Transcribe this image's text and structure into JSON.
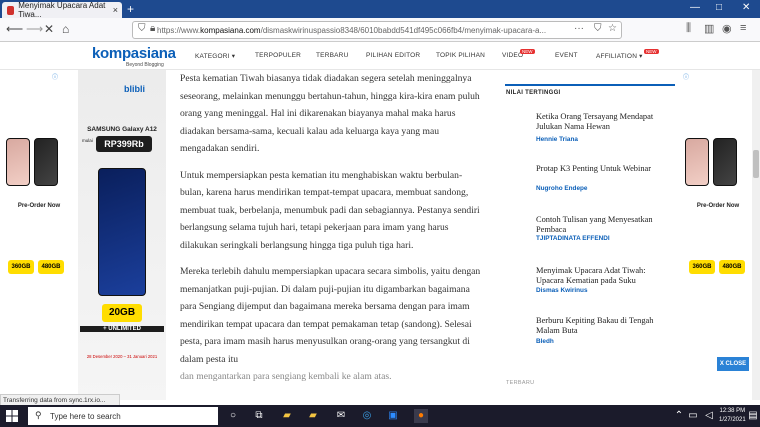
{
  "browser": {
    "tab_title": "Menyimak Upacara Adat Tiwa...",
    "tab_close": "×",
    "new_tab": "+",
    "url_prefix": "https://www.",
    "url_domain": "kompasiana.com",
    "url_rest": "/dismaskwirinuspassio8348/6010babdd541df495c066fb4/menyimak-upacara-a...",
    "url_more": "···",
    "status": "Transferring data from sync.1rx.io...",
    "win_min": "—",
    "win_max": "□",
    "win_close": "✕"
  },
  "site": {
    "logo": "kompasiana",
    "tagline": "Beyond Blogging",
    "menu": [
      {
        "label": "KATEGORI ▾"
      },
      {
        "label": "TERPOPULER"
      },
      {
        "label": "TERBARU"
      },
      {
        "label": "PILIHAN EDITOR"
      },
      {
        "label": "TOPIK PILIHAN"
      },
      {
        "label": "VIDEO"
      },
      {
        "label": "EVENT"
      },
      {
        "label": "AFFILIATION ▾"
      }
    ],
    "new_badge": "NEW"
  },
  "ad": {
    "brand": "blibli",
    "phone_name": "SAMSUNG Galaxy A12",
    "price_prefix": "mulai",
    "price": "RP399Rb",
    "data": "20GB",
    "unlimited": "+ UNLIMITED",
    "promo_dates": "28 Desember 2020 – 31 Januari 2021",
    "preorder": "Pre-Order Now",
    "side_promo1": "360GB",
    "side_promo2": "480GB",
    "info": "ⓘ"
  },
  "article": {
    "paragraphs": [
      "Pesta kematian Tiwah biasanya tidak diadakan segera setelah meninggalnya seseorang, melainkan menunggu bertahun-tahun, hingga kira-kira enam puluh orang yang meninggal. Hal ini dikarenakan biayanya mahal maka harus diadakan bersama-sama, kecuali kalau ada keluarga kaya yang mau mengadakan sendiri.",
      "Untuk mempersiapkan pesta kematian itu menghabiskan waktu berbulan-bulan, karena harus mendirikan tempat-tempat upacara, membuat sandong, membuat tuak, berbelanja, menumbuk padi dan sebagiannya. Pestanya sendiri berlangsung selama tujuh hari, tetapi pekerjaan para imam yang harus dilakukan seringkali berlangsung hingga tiga puluh tiga hari.",
      "Mereka terlebih dahulu mempersiapkan upacara secara simbolis, yaitu dengan memanjatkan puji-pujian. Di dalam puji-pujian itu digambarkan bagaimana para Sengiang dijemput dan bagaimana mereka bersama dengan para imam mendirikan tempat upacara dan tempat pemakaman tetap (sandong). Selesai pesta, para imam masih harus menyusulkan orang-orang yang tersangkut di dalam pesta itu",
      "dan mengantarkan para sengiang kembali ke alam atas."
    ]
  },
  "sidebar": {
    "heading": "NILAI TERTINGGI",
    "items": [
      {
        "title": "Ketika Orang Tersayang Mendapat Julukan Nama Hewan",
        "author": "Hennie Triana"
      },
      {
        "title": "Protap K3 Penting Untuk Webinar",
        "author": "Nugroho Endepe"
      },
      {
        "title": "Contoh Tulisan yang Menyesatkan Pembaca",
        "author": "TJIPTADINATA EFFENDI"
      },
      {
        "title": "Menyimak Upacara Adat Tiwah: Upacara Kematian pada Suku",
        "author": "Dismas Kwirinus"
      },
      {
        "title": "Berburu Kepiting Bakau di Tengah Malam Buta",
        "author": "Bledh"
      }
    ],
    "heading2": "TERBARU"
  },
  "popup": {
    "close_label": "X CLOSE"
  },
  "taskbar": {
    "search_placeholder": "Type here to search",
    "time": "12:38 PM",
    "date": "1/27/2021"
  }
}
